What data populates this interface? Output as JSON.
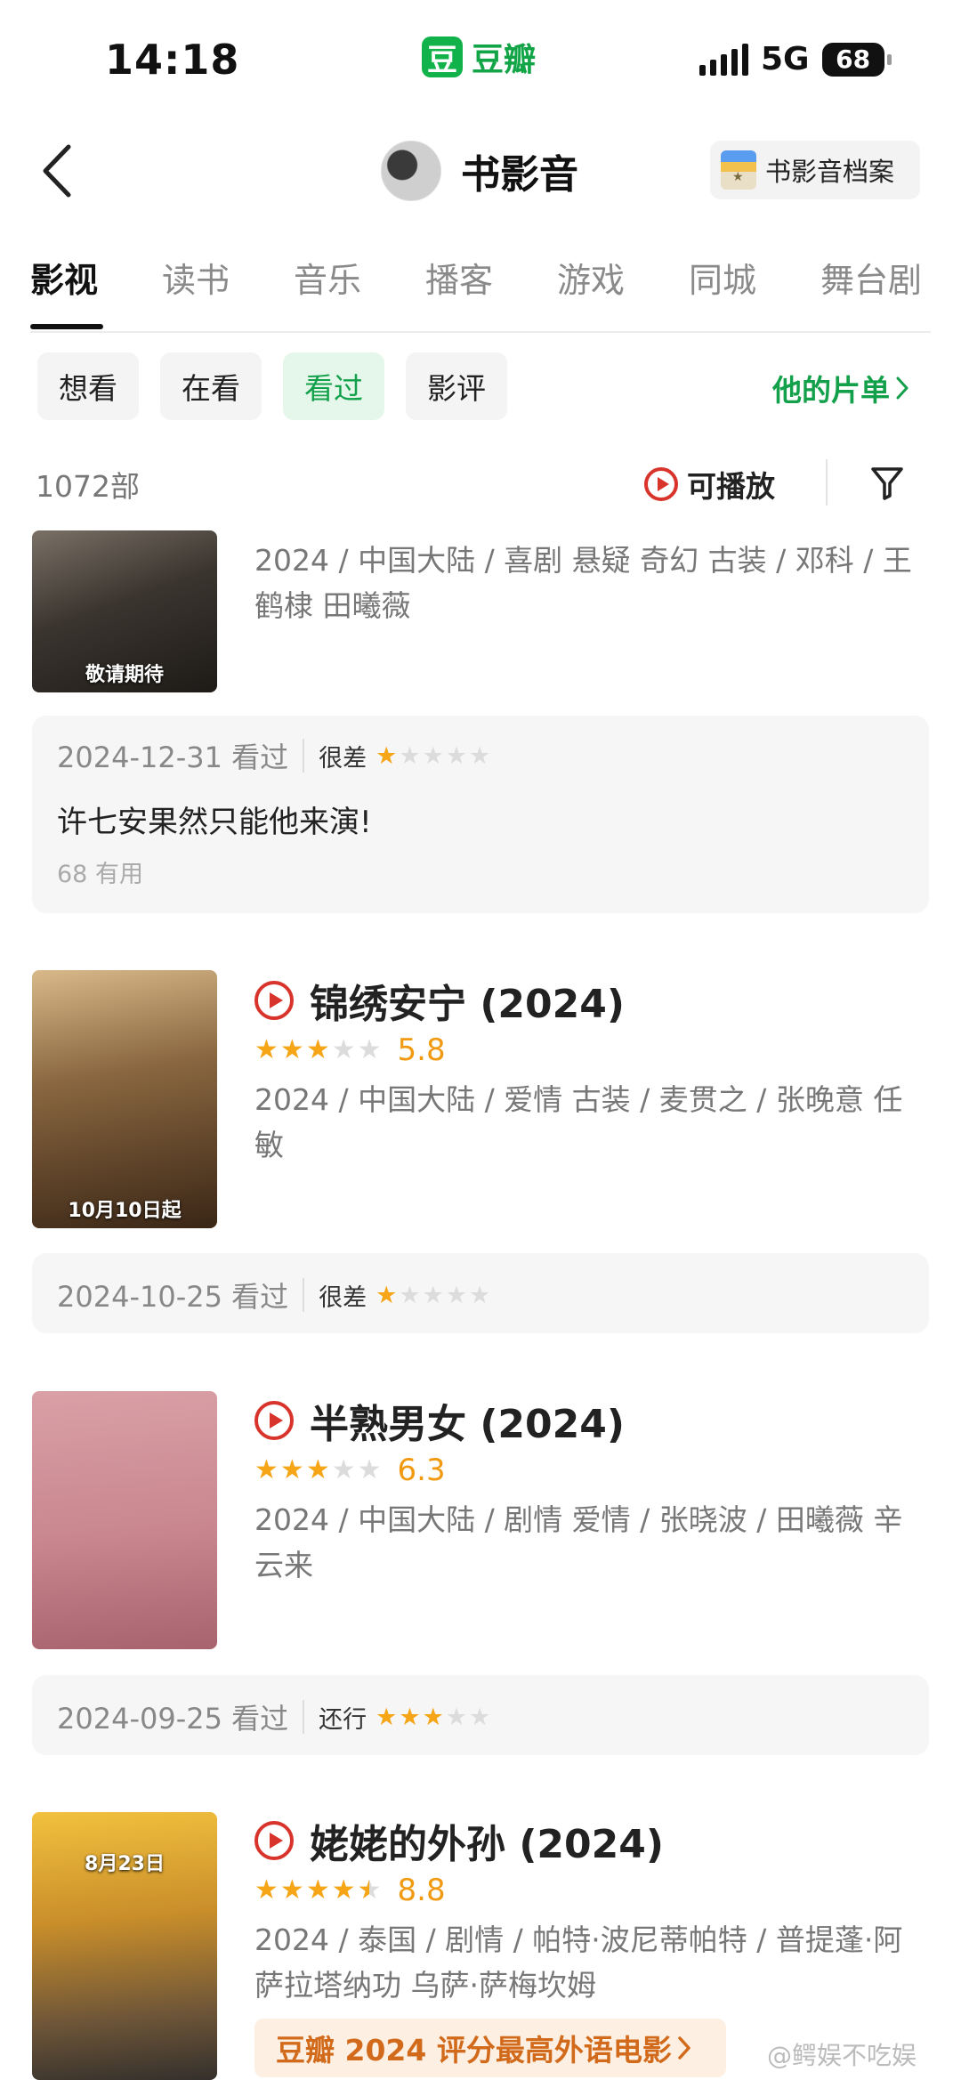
{
  "status_bar": {
    "time": "14:18",
    "app_name": "豆瓣",
    "app_logo_text": "豆",
    "network": "5G",
    "battery": "68"
  },
  "nav": {
    "title": "书影音",
    "archive_label": "书影音档案"
  },
  "tabs": [
    {
      "label": "影视",
      "active": true
    },
    {
      "label": "读书"
    },
    {
      "label": "音乐"
    },
    {
      "label": "播客"
    },
    {
      "label": "游戏"
    },
    {
      "label": "同城"
    },
    {
      "label": "舞台剧"
    }
  ],
  "filters": [
    {
      "label": "想看"
    },
    {
      "label": "在看"
    },
    {
      "label": "看过",
      "active": true
    },
    {
      "label": "影评"
    }
  ],
  "doulist_link": "他的片单",
  "count": "1072部",
  "playable_label": "可播放",
  "items": [
    {
      "title": "",
      "meta": "2024 / 中国大陆 / 喜剧 悬疑 奇幻 古装 / 邓科 / 王鹤棣 田曦薇",
      "poster_caption": "敬请期待",
      "review": {
        "date": "2024-12-31 看过",
        "level": "很差",
        "user_stars": 1,
        "text": "许七安果然只能他来演!",
        "useful": "68 有用"
      }
    },
    {
      "title": "锦绣安宁 (2024)",
      "score": "5.8",
      "rating_stars": 3,
      "meta": "2024 / 中国大陆 / 爱情 古装 / 麦贯之 / 张晚意 任敏",
      "poster_caption": "10月10日起",
      "review": {
        "date": "2024-10-25 看过",
        "level": "很差",
        "user_stars": 1
      }
    },
    {
      "title": "半熟男女 (2024)",
      "score": "6.3",
      "rating_stars": 3,
      "meta": "2024 / 中国大陆 / 剧情 爱情 / 张晓波 / 田曦薇 辛云来",
      "poster_caption": "",
      "review": {
        "date": "2024-09-25 看过",
        "level": "还行",
        "user_stars": 3
      }
    },
    {
      "title": "姥姥的外孙 (2024)",
      "score": "8.8",
      "rating_stars": 4.5,
      "meta": "2024 / 泰国 / 剧情 / 帕特·波尼蒂帕特 / 普提蓬·阿萨拉塔纳功 乌萨·萨梅坎姆",
      "poster_caption": "8月23日",
      "promo": "豆瓣 2024 评分最高外语电影"
    }
  ],
  "watermark": "@鳄娱不吃娱",
  "colors": {
    "green": "#13a04a",
    "star": "#f5a516",
    "play_red": "#d9342b",
    "promo_orange": "#d26a1c"
  }
}
